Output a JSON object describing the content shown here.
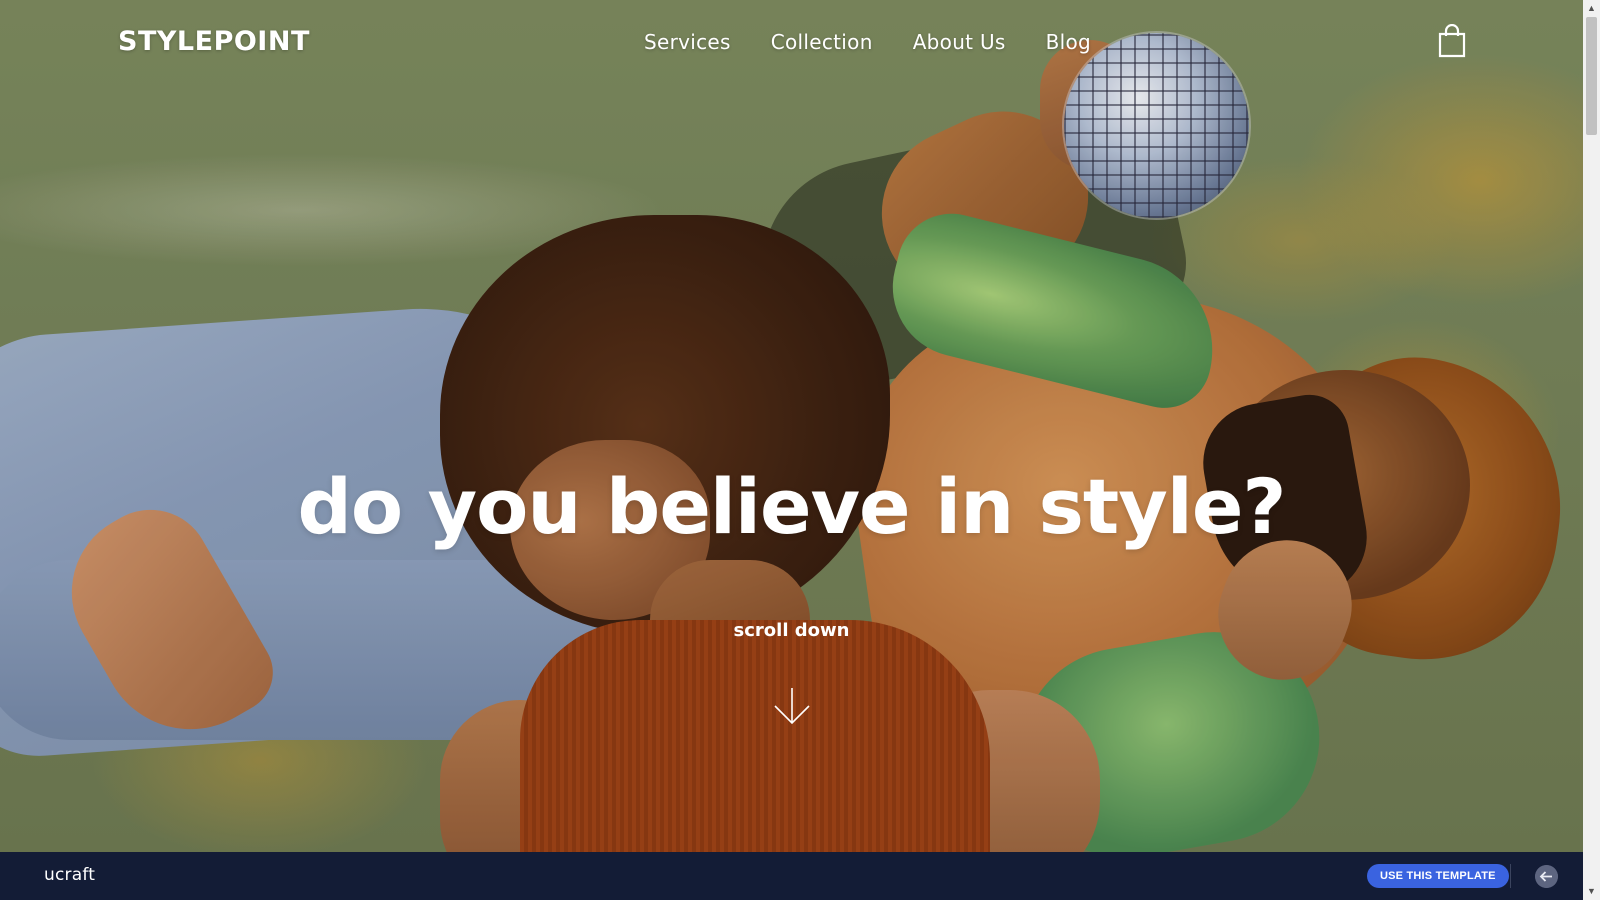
{
  "header": {
    "logo": "STYLEPOINT",
    "nav": [
      "Services",
      "Collection",
      "About Us",
      "Blog"
    ]
  },
  "hero": {
    "headline": "do you believe in style?",
    "scroll_label": "scroll down"
  },
  "builder_bar": {
    "brand": "ucraft",
    "cta_label": "USE THIS TEMPLATE"
  },
  "icons": {
    "cart": "shopping-bag-icon",
    "scroll": "arrow-down-icon",
    "back": "arrow-left-icon"
  },
  "colors": {
    "text": "#ffffff",
    "builder_bar": "#131c36",
    "cta": "#3a63e0"
  }
}
